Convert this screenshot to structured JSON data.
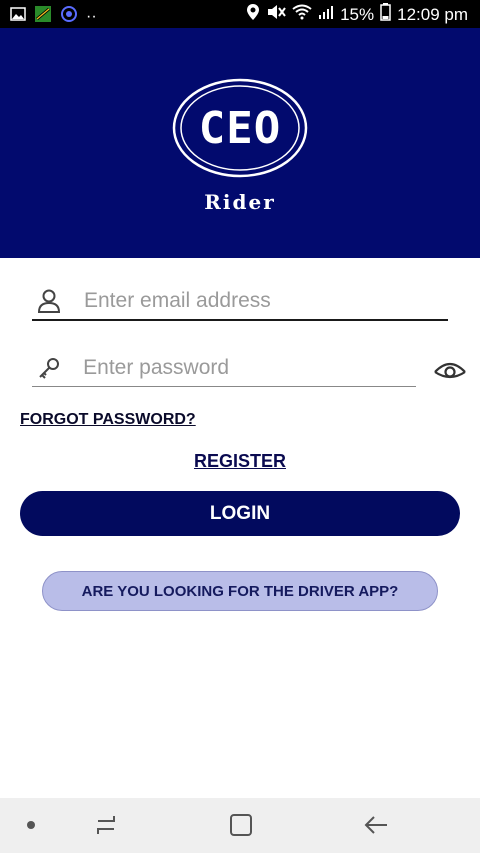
{
  "status_bar": {
    "left_dots": "··",
    "battery": "15%",
    "time": "12:09 pm"
  },
  "header": {
    "logo_text": "CEO",
    "subtitle": "Rider",
    "background": "#020a6e"
  },
  "form": {
    "email_placeholder": "Enter email address",
    "password_placeholder": "Enter password",
    "forgot_label": "FORGOT PASSWORD?",
    "register_label": "REGISTER",
    "login_label": "LOGIN",
    "driver_label": "ARE YOU LOOKING FOR THE DRIVER APP?"
  },
  "icons": {
    "email": "user-icon",
    "password": "key-icon",
    "visibility": "eye-icon"
  },
  "colors": {
    "primary": "#020a5e",
    "driver_button": "#b9bde8"
  }
}
